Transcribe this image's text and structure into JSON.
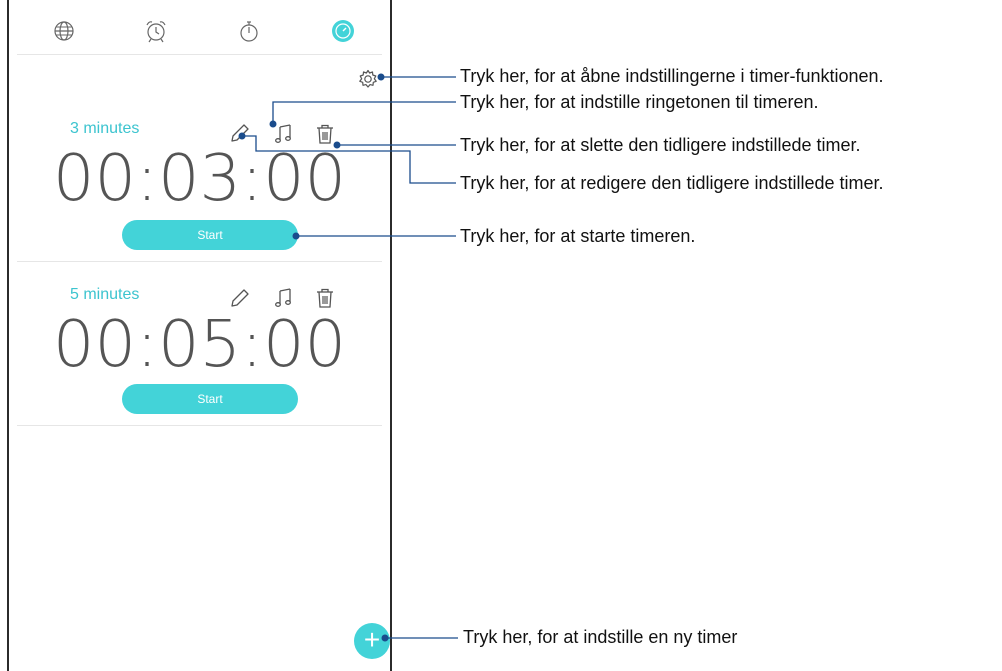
{
  "tabs": [
    {
      "icon": "globe-icon"
    },
    {
      "icon": "alarm-clock-icon"
    },
    {
      "icon": "stopwatch-icon"
    },
    {
      "icon": "timer-icon",
      "active": true
    }
  ],
  "accent_color": "#43d3d8",
  "timers": [
    {
      "name": "3 minutes",
      "time": "00:03:00",
      "start_label": "Start"
    },
    {
      "name": "5 minutes",
      "time": "00:05:00",
      "start_label": "Start"
    }
  ],
  "fab_label": "+",
  "annotations": {
    "settings": "Tryk her, for at åbne indstillingerne i timer-funktionen.",
    "ringtone": "Tryk her, for at indstille ringetonen til timeren.",
    "delete": "Tryk her, for at slette den tidligere indstillede timer.",
    "edit": "Tryk her, for at redigere den tidligere indstillede timer.",
    "start": "Tryk her, for at starte timeren.",
    "new": "Tryk her, for at indstille en ny timer"
  }
}
